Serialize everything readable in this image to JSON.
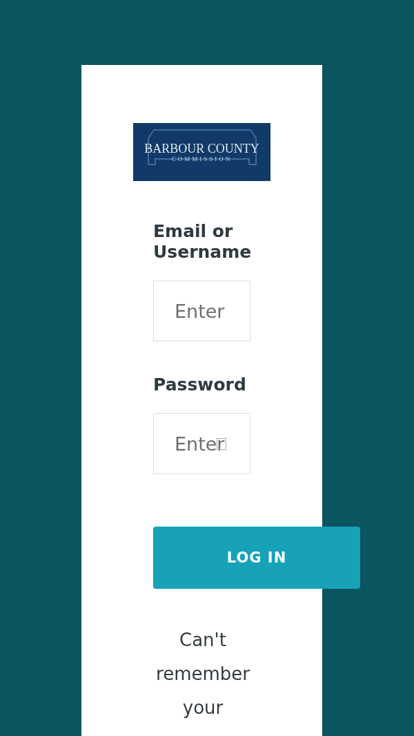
{
  "logo": {
    "title": "BARBOUR COUNTY",
    "subtitle": "COMMISSION"
  },
  "fields": [
    {
      "label": "Email or Username",
      "placeholder": "Enter",
      "kind": "text"
    },
    {
      "label": "Password",
      "placeholder": "Enter",
      "kind": "password"
    }
  ],
  "login_button": "LOG IN",
  "forgot_text": "Can't remember your"
}
